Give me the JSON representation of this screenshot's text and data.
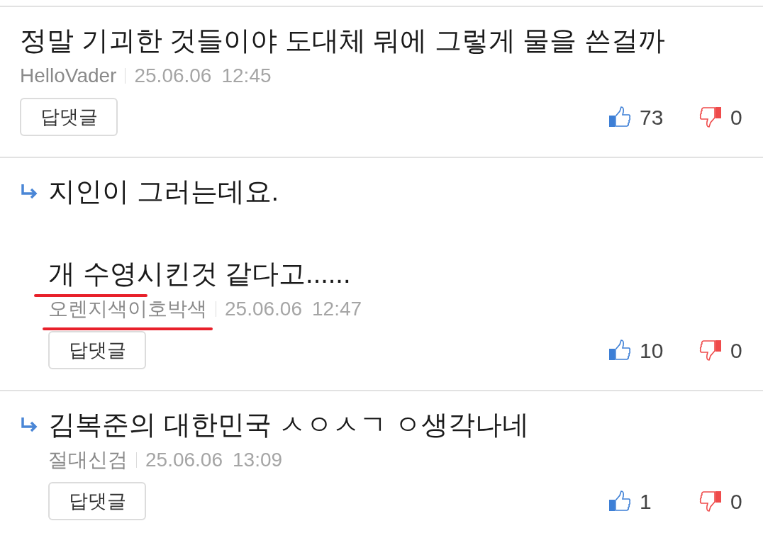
{
  "comments": [
    {
      "reply": false,
      "text": "정말 기괴한 것들이야 도대체 뭐에 그렇게 물을 쓴걸까",
      "marked_text": false,
      "author": "HelloVader",
      "marked_author": false,
      "date": "25.06.06",
      "time": "12:45",
      "reply_button": "답댓글",
      "likes": "73",
      "dislikes": "0"
    },
    {
      "reply": true,
      "text": "지인이 그러는데요.\n\n개 수영시킨것 같다고......",
      "marked_text": true,
      "author": "오렌지색이호박색",
      "marked_author": true,
      "date": "25.06.06",
      "time": "12:47",
      "reply_button": "답댓글",
      "likes": "10",
      "dislikes": "0"
    },
    {
      "reply": true,
      "text": "김복준의 대한민국 ㅅㅇㅅㄱ ㅇ생각나네",
      "marked_text": false,
      "author": "절대신검",
      "date": "25.06.06",
      "time": "13:09",
      "marked_author": false,
      "reply_button": "답댓글",
      "likes": "1",
      "dislikes": "0"
    }
  ]
}
